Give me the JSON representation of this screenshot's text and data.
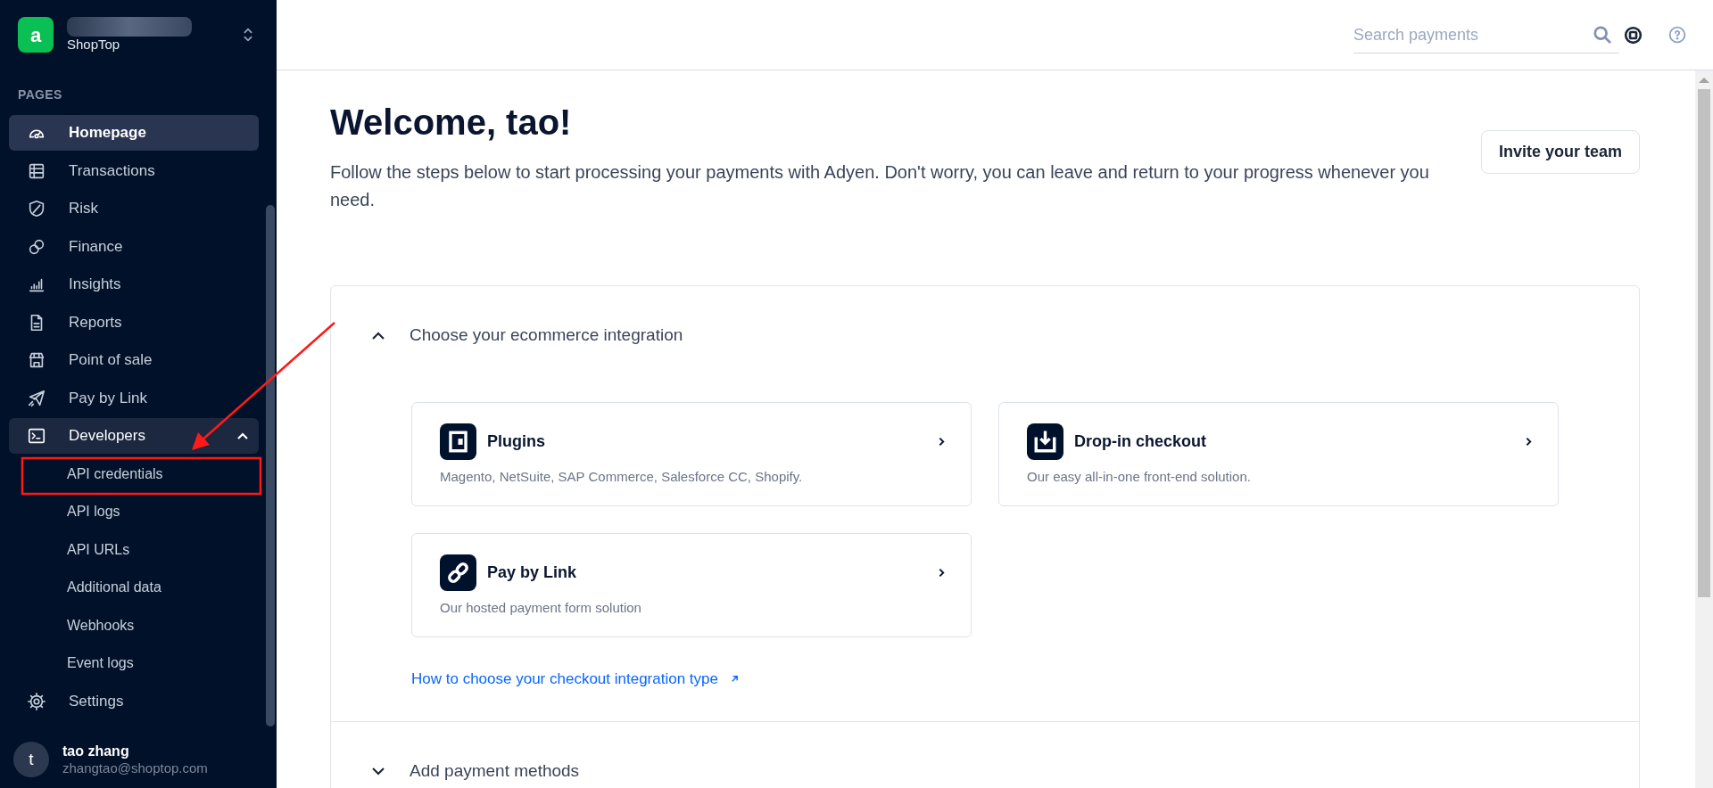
{
  "account": {
    "name": "ShopTop",
    "logo_letter": "a"
  },
  "sidebar": {
    "section_label": "PAGES",
    "items": [
      {
        "label": "Homepage",
        "selected": true
      },
      {
        "label": "Transactions",
        "selected": false
      },
      {
        "label": "Risk",
        "selected": false
      },
      {
        "label": "Finance",
        "selected": false
      },
      {
        "label": "Insights",
        "selected": false
      },
      {
        "label": "Reports",
        "selected": false
      },
      {
        "label": "Point of sale",
        "selected": false
      },
      {
        "label": "Pay by Link",
        "selected": false
      },
      {
        "label": "Developers",
        "selected": false,
        "expanded": true,
        "children": [
          {
            "label": "API credentials",
            "selected": false
          },
          {
            "label": "API logs",
            "selected": false
          },
          {
            "label": "API URLs",
            "selected": false
          },
          {
            "label": "Additional data",
            "selected": false
          },
          {
            "label": "Webhooks",
            "selected": false
          },
          {
            "label": "Event logs",
            "selected": false
          }
        ]
      },
      {
        "label": "Settings",
        "selected": false
      }
    ]
  },
  "user": {
    "initial": "t",
    "name": "tao zhang",
    "email": "zhangtao@shoptop.com"
  },
  "search": {
    "placeholder": "Search payments"
  },
  "title": "Welcome, tao!",
  "intro": "Follow the steps below to start processing your payments with Adyen. Don't worry, you can leave and return to your progress whenever you need.",
  "invite_button": "Invite your team",
  "sections": [
    {
      "title": "Choose your ecommerce integration",
      "expanded": true,
      "cards": [
        {
          "title": "Plugins",
          "description": "Magento, NetSuite, SAP Commerce, Salesforce CC, Shopify."
        },
        {
          "title": "Drop-in checkout",
          "description": "Our easy all-in-one front-end solution."
        },
        {
          "title": "Pay by Link",
          "description": "Our hosted payment form solution"
        }
      ],
      "link": "How to choose your checkout integration type"
    },
    {
      "title": "Add payment methods",
      "expanded": false
    }
  ]
}
